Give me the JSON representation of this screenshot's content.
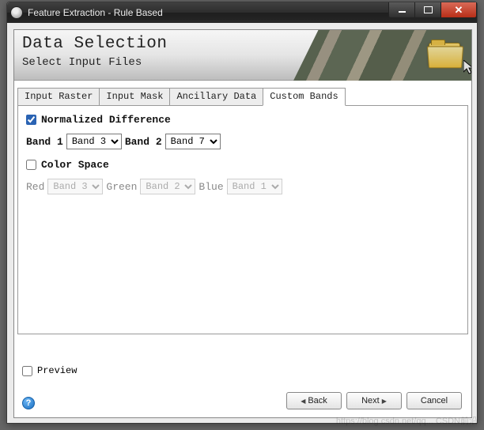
{
  "window": {
    "title": "Feature Extraction - Rule Based"
  },
  "header": {
    "title": "Data Selection",
    "subtitle": "Select Input Files"
  },
  "tabs": {
    "items": [
      {
        "label": "Input Raster"
      },
      {
        "label": "Input Mask"
      },
      {
        "label": "Ancillary Data"
      },
      {
        "label": "Custom Bands"
      }
    ],
    "active_index": 3
  },
  "custom_bands": {
    "normalized_difference": {
      "label": "Normalized Difference",
      "checked": true,
      "band1_label": "Band 1",
      "band1_value": "Band 3",
      "band2_label": "Band 2",
      "band2_value": "Band 7"
    },
    "color_space": {
      "label": "Color Space",
      "checked": false,
      "red_label": "Red",
      "red_value": "Band 3",
      "green_label": "Green",
      "green_value": "Band 2",
      "blue_label": "Blue",
      "blue_value": "Band 1"
    }
  },
  "footer": {
    "preview_label": "Preview",
    "preview_checked": false,
    "back_label": "Back",
    "next_label": "Next",
    "cancel_label": "Cancel"
  },
  "watermark": "https://blog.csdn.net/qq... CSDN前沿"
}
